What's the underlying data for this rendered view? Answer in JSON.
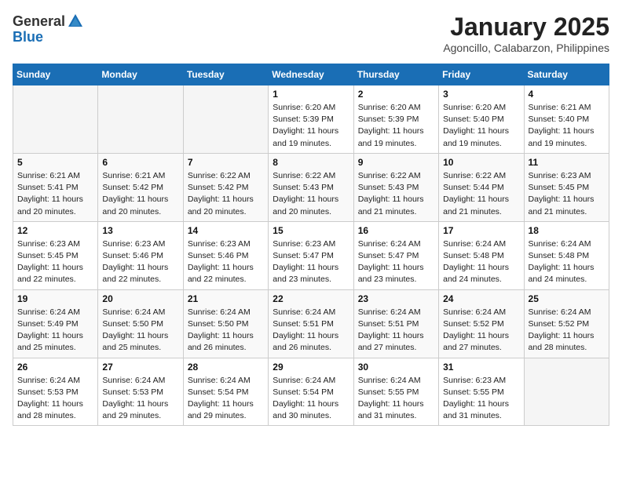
{
  "header": {
    "logo_general": "General",
    "logo_blue": "Blue",
    "title": "January 2025",
    "subtitle": "Agoncillo, Calabarzon, Philippines"
  },
  "weekdays": [
    "Sunday",
    "Monday",
    "Tuesday",
    "Wednesday",
    "Thursday",
    "Friday",
    "Saturday"
  ],
  "weeks": [
    [
      {
        "day": "",
        "sunrise": "",
        "sunset": "",
        "daylight": ""
      },
      {
        "day": "",
        "sunrise": "",
        "sunset": "",
        "daylight": ""
      },
      {
        "day": "",
        "sunrise": "",
        "sunset": "",
        "daylight": ""
      },
      {
        "day": "1",
        "sunrise": "6:20 AM",
        "sunset": "5:39 PM",
        "daylight": "11 hours and 19 minutes."
      },
      {
        "day": "2",
        "sunrise": "6:20 AM",
        "sunset": "5:39 PM",
        "daylight": "11 hours and 19 minutes."
      },
      {
        "day": "3",
        "sunrise": "6:20 AM",
        "sunset": "5:40 PM",
        "daylight": "11 hours and 19 minutes."
      },
      {
        "day": "4",
        "sunrise": "6:21 AM",
        "sunset": "5:40 PM",
        "daylight": "11 hours and 19 minutes."
      }
    ],
    [
      {
        "day": "5",
        "sunrise": "6:21 AM",
        "sunset": "5:41 PM",
        "daylight": "11 hours and 20 minutes."
      },
      {
        "day": "6",
        "sunrise": "6:21 AM",
        "sunset": "5:42 PM",
        "daylight": "11 hours and 20 minutes."
      },
      {
        "day": "7",
        "sunrise": "6:22 AM",
        "sunset": "5:42 PM",
        "daylight": "11 hours and 20 minutes."
      },
      {
        "day": "8",
        "sunrise": "6:22 AM",
        "sunset": "5:43 PM",
        "daylight": "11 hours and 20 minutes."
      },
      {
        "day": "9",
        "sunrise": "6:22 AM",
        "sunset": "5:43 PM",
        "daylight": "11 hours and 21 minutes."
      },
      {
        "day": "10",
        "sunrise": "6:22 AM",
        "sunset": "5:44 PM",
        "daylight": "11 hours and 21 minutes."
      },
      {
        "day": "11",
        "sunrise": "6:23 AM",
        "sunset": "5:45 PM",
        "daylight": "11 hours and 21 minutes."
      }
    ],
    [
      {
        "day": "12",
        "sunrise": "6:23 AM",
        "sunset": "5:45 PM",
        "daylight": "11 hours and 22 minutes."
      },
      {
        "day": "13",
        "sunrise": "6:23 AM",
        "sunset": "5:46 PM",
        "daylight": "11 hours and 22 minutes."
      },
      {
        "day": "14",
        "sunrise": "6:23 AM",
        "sunset": "5:46 PM",
        "daylight": "11 hours and 22 minutes."
      },
      {
        "day": "15",
        "sunrise": "6:23 AM",
        "sunset": "5:47 PM",
        "daylight": "11 hours and 23 minutes."
      },
      {
        "day": "16",
        "sunrise": "6:24 AM",
        "sunset": "5:47 PM",
        "daylight": "11 hours and 23 minutes."
      },
      {
        "day": "17",
        "sunrise": "6:24 AM",
        "sunset": "5:48 PM",
        "daylight": "11 hours and 24 minutes."
      },
      {
        "day": "18",
        "sunrise": "6:24 AM",
        "sunset": "5:48 PM",
        "daylight": "11 hours and 24 minutes."
      }
    ],
    [
      {
        "day": "19",
        "sunrise": "6:24 AM",
        "sunset": "5:49 PM",
        "daylight": "11 hours and 25 minutes."
      },
      {
        "day": "20",
        "sunrise": "6:24 AM",
        "sunset": "5:50 PM",
        "daylight": "11 hours and 25 minutes."
      },
      {
        "day": "21",
        "sunrise": "6:24 AM",
        "sunset": "5:50 PM",
        "daylight": "11 hours and 26 minutes."
      },
      {
        "day": "22",
        "sunrise": "6:24 AM",
        "sunset": "5:51 PM",
        "daylight": "11 hours and 26 minutes."
      },
      {
        "day": "23",
        "sunrise": "6:24 AM",
        "sunset": "5:51 PM",
        "daylight": "11 hours and 27 minutes."
      },
      {
        "day": "24",
        "sunrise": "6:24 AM",
        "sunset": "5:52 PM",
        "daylight": "11 hours and 27 minutes."
      },
      {
        "day": "25",
        "sunrise": "6:24 AM",
        "sunset": "5:52 PM",
        "daylight": "11 hours and 28 minutes."
      }
    ],
    [
      {
        "day": "26",
        "sunrise": "6:24 AM",
        "sunset": "5:53 PM",
        "daylight": "11 hours and 28 minutes."
      },
      {
        "day": "27",
        "sunrise": "6:24 AM",
        "sunset": "5:53 PM",
        "daylight": "11 hours and 29 minutes."
      },
      {
        "day": "28",
        "sunrise": "6:24 AM",
        "sunset": "5:54 PM",
        "daylight": "11 hours and 29 minutes."
      },
      {
        "day": "29",
        "sunrise": "6:24 AM",
        "sunset": "5:54 PM",
        "daylight": "11 hours and 30 minutes."
      },
      {
        "day": "30",
        "sunrise": "6:24 AM",
        "sunset": "5:55 PM",
        "daylight": "11 hours and 31 minutes."
      },
      {
        "day": "31",
        "sunrise": "6:23 AM",
        "sunset": "5:55 PM",
        "daylight": "11 hours and 31 minutes."
      },
      {
        "day": "",
        "sunrise": "",
        "sunset": "",
        "daylight": ""
      }
    ]
  ],
  "labels": {
    "sunrise_prefix": "Sunrise: ",
    "sunset_prefix": "Sunset: ",
    "daylight_prefix": "Daylight: "
  }
}
